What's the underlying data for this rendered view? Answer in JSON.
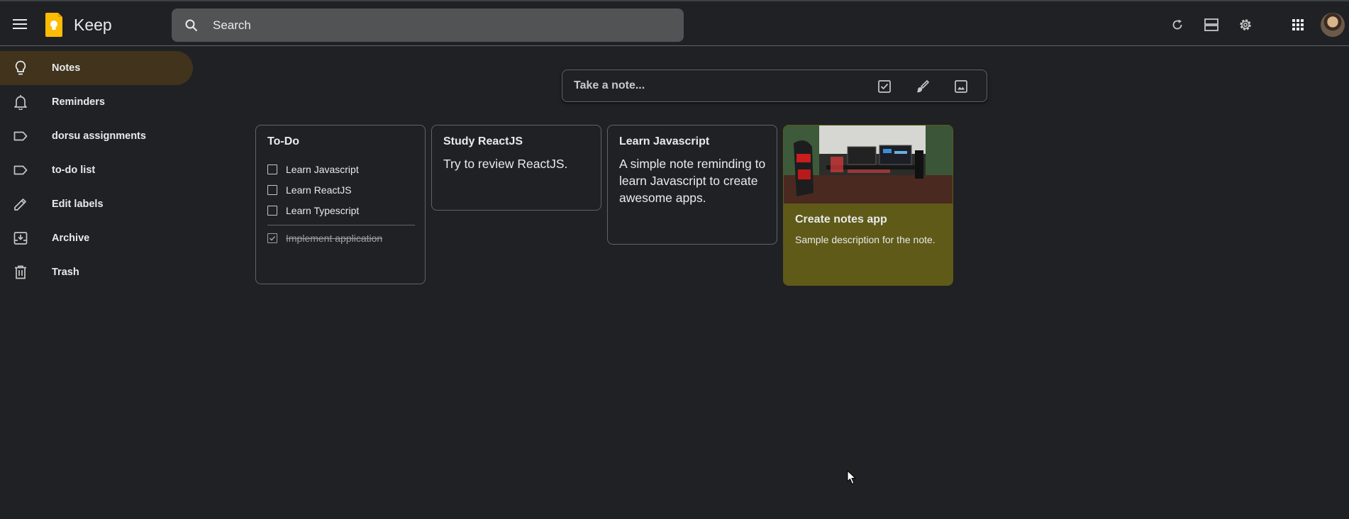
{
  "header": {
    "app_name": "Keep",
    "search_placeholder": "Search",
    "accent_color": "#fbbc04"
  },
  "sidebar": {
    "items": [
      {
        "label": "Notes",
        "icon": "lightbulb-icon",
        "active": true
      },
      {
        "label": "Reminders",
        "icon": "bell-icon"
      },
      {
        "label": "dorsu assignments",
        "icon": "label-icon"
      },
      {
        "label": "to-do list",
        "icon": "label-icon"
      },
      {
        "label": "Edit labels",
        "icon": "pencil-icon"
      },
      {
        "label": "Archive",
        "icon": "archive-icon"
      },
      {
        "label": "Trash",
        "icon": "trash-icon"
      }
    ]
  },
  "take_note": {
    "placeholder": "Take a note..."
  },
  "notes": {
    "todo": {
      "title": "To-Do",
      "items": [
        {
          "text": "Learn Javascript",
          "checked": false
        },
        {
          "text": "Learn ReactJS",
          "checked": false
        },
        {
          "text": "Learn Typescript",
          "checked": false
        }
      ],
      "completed": [
        {
          "text": "Implement application",
          "checked": true
        }
      ]
    },
    "react": {
      "title": "Study ReactJS",
      "body": "Try to review ReactJS."
    },
    "javascript": {
      "title": "Learn Javascript",
      "body": "A simple note reminding to learn Javascript to create awesome apps."
    },
    "notes_app": {
      "title": "Create notes app",
      "description": "Sample description for the note.",
      "background_color": "#5f5a17"
    }
  }
}
